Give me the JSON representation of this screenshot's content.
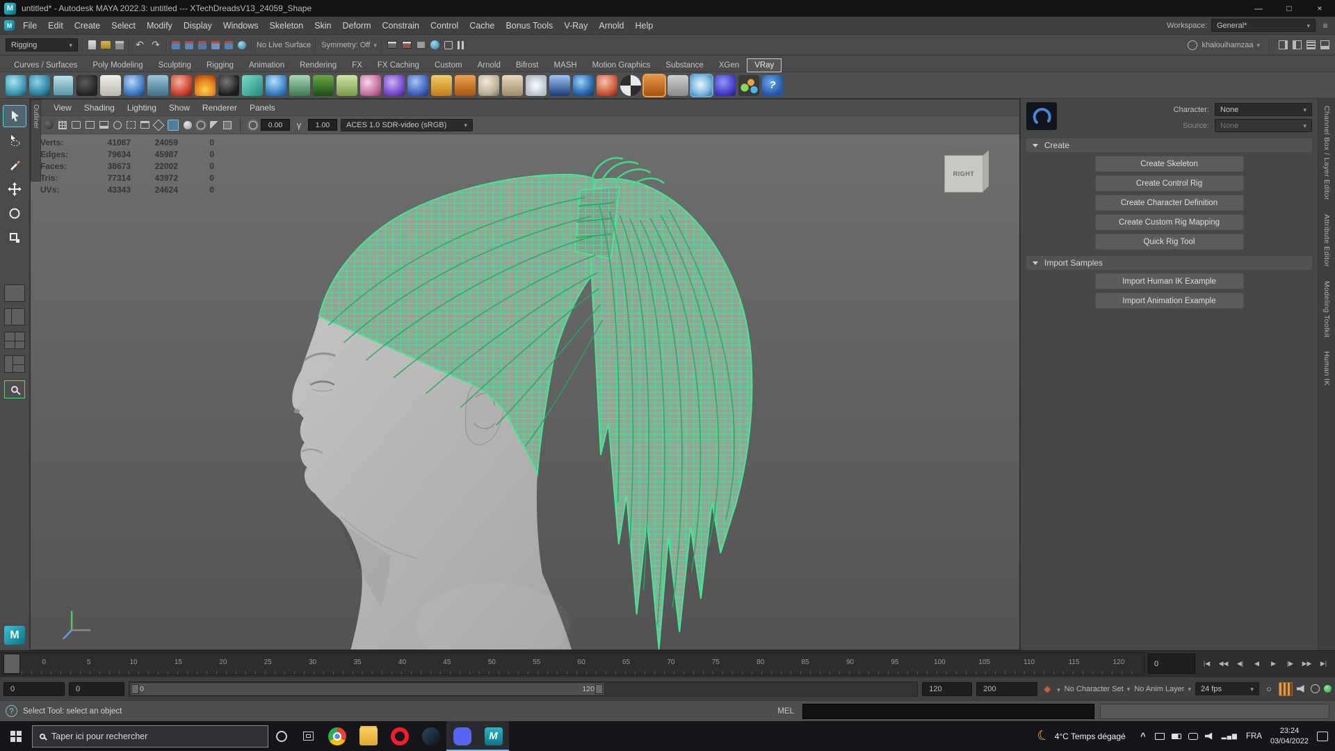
{
  "window": {
    "title": "untitled* - Autodesk MAYA 2022.3: untitled   ---   XTechDreadsV13_24059_Shape",
    "maya_logo_glyph": "M",
    "minimize": "—",
    "maximize": "□",
    "close": "×"
  },
  "menu_bar": {
    "items": [
      "File",
      "Edit",
      "Create",
      "Select",
      "Modify",
      "Display",
      "Windows",
      "Skeleton",
      "Skin",
      "Deform",
      "Constrain",
      "Control",
      "Cache",
      "Bonus Tools",
      "V-Ray",
      "Arnold",
      "Help"
    ],
    "workspace_label": "Workspace:",
    "workspace_value": "General*"
  },
  "status_line": {
    "mode_selector": "Rigging",
    "file_icons": [
      {
        "name": "new-scene-icon",
        "style": "width:11px;height:13px;background:linear-gradient(#dcdcdc,#b2b2b2);border-radius:1px"
      },
      {
        "name": "open-scene-icon",
        "style": "width:14px;height:11px;background:linear-gradient(#d8b450,#b08428);border-radius:2px"
      },
      {
        "name": "save-scene-icon",
        "style": "width:12px;height:12px;background:linear-gradient(#bdbdbd 0 30%,#8a8a8a 30%);border-radius:1px"
      }
    ],
    "history_icons": [
      {
        "name": "undo-icon",
        "glyph": "↶",
        "style": "color:#c9c9c9;font-size:14px"
      },
      {
        "name": "redo-icon",
        "glyph": "↷",
        "style": "color:#c9c9c9;font-size:14px"
      }
    ],
    "snap_icons": [
      {
        "name": "snap-grid-icon",
        "style": "width:12px;height:12px;border-radius:2px;background:linear-gradient(#b84a38 0 30%,#4a86ba 30%)"
      },
      {
        "name": "snap-curve-icon",
        "style": "width:12px;height:12px;border-radius:2px;background:linear-gradient(#b84a38 0 30%,#558cc0 30%)"
      },
      {
        "name": "snap-point-icon",
        "style": "width:12px;height:12px;border-radius:2px;background:linear-gradient(#b84a38 0 30%,#4a7ab0 30%)"
      },
      {
        "name": "snap-projected-center-icon",
        "style": "width:12px;height:12px;border-radius:2px;background:linear-gradient(#b84a38 0 30%,#6a96c4 30%)"
      },
      {
        "name": "snap-view-plane-icon",
        "style": "width:12px;height:12px;border-radius:2px;background:linear-gradient(#b84a38 0 30%,#4a86ba 30%)"
      },
      {
        "name": "make-live-icon",
        "style": "width:12px;height:12px;border-radius:50%;background:radial-gradient(circle at 35% 30%,#9adcf0,#2a7c9c)"
      }
    ],
    "live_surface": "No Live Surface",
    "symmetry": "Symmetry: Off",
    "render_icons": [
      {
        "name": "render-frame-icon",
        "style": "width:14px;height:11px;border:1px solid #2e2e2e;background:linear-gradient(#d8d8d8 0 30%,#666 30%)"
      },
      {
        "name": "ipr-render-icon",
        "style": "width:14px;height:11px;border:1px solid #2e2e2e;background:linear-gradient(#d8d8d8 0 30%,#8a5a4a 30%)"
      },
      {
        "name": "render-settings-icon",
        "style": "width:13px;height:11px;background:#9a9a9a;border:1px solid #444"
      },
      {
        "name": "render-view-icon",
        "style": "width:13px;height:13px;border-radius:50%;background:radial-gradient(circle at 35% 30%,#9adcf0,#2a7c9c)"
      },
      {
        "name": "launch-mash-icon",
        "style": "width:12px;height:12px;border:1px solid #c4c4c4;border-radius:2px"
      },
      {
        "name": "pause-viewport-icon",
        "style": "width:9px;height:12px;background:linear-gradient(90deg,#c8c8c8 0 3px,transparent 3px 6px,#c8c8c8 6px 9px)"
      }
    ],
    "account": "khalouihamzaa",
    "sidebar_icons": [
      {
        "name": "attribute-editor-toggle-icon",
        "style": "width:13px;height:13px;border:1px solid #b8b8b8;background:linear-gradient(90deg,transparent 0 8px,#b8b8b8 8px)"
      },
      {
        "name": "tool-settings-toggle-icon",
        "style": "width:13px;height:13px;border:1px solid #b8b8b8;background:linear-gradient(90deg,#b8b8b8 0 4px,transparent 4px)"
      },
      {
        "name": "channel-box-toggle-icon",
        "style": "width:13px;height:13px;border:1px solid #b8b8b8;background:repeating-linear-gradient(0deg,#b8b8b8 0 2px,transparent 2px 4px)"
      },
      {
        "name": "workspace-panel-toggle-icon",
        "style": "width:13px;height:13px;border:1px solid #b8b8b8;background:linear-gradient(0deg,#b8b8b8 0 4px,transparent 4px)"
      }
    ]
  },
  "shelf": {
    "tabs": [
      {
        "label": "Curves / Surfaces",
        "active": "false"
      },
      {
        "label": "Poly Modeling",
        "active": "false"
      },
      {
        "label": "Sculpting",
        "active": "false"
      },
      {
        "label": "Rigging",
        "active": "false"
      },
      {
        "label": "Animation",
        "active": "false"
      },
      {
        "label": "Rendering",
        "active": "false"
      },
      {
        "label": "FX",
        "active": "false"
      },
      {
        "label": "FX Caching",
        "active": "false"
      },
      {
        "label": "Custom",
        "active": "false"
      },
      {
        "label": "Arnold",
        "active": "false"
      },
      {
        "label": "Bifrost",
        "active": "false"
      },
      {
        "label": "MASH",
        "active": "false"
      },
      {
        "label": "Motion Graphics",
        "active": "false"
      },
      {
        "label": "Substance",
        "active": "false"
      },
      {
        "label": "XGen",
        "active": "false"
      },
      {
        "label": "VRay",
        "active": "true"
      }
    ],
    "icons": [
      {
        "name": "wire-sphere-icon",
        "style": "background:radial-gradient(circle at 38% 32%,#aee4ef,#3e98b4 60%,#174654)"
      },
      {
        "name": "wire-spheres-pair-icon",
        "style": "background:radial-gradient(circle at 38% 32%,#8ed4e4,#2f84a4 62%,#123c4c)"
      },
      {
        "name": "uv-grid-icon",
        "style": "background:linear-gradient(#bfe2ea,#5b93a4);box-shadow:inset 0 0 0 1px #2e5866"
      },
      {
        "name": "dark-teapot-icon",
        "style": "background:radial-gradient(circle at 40% 35%,#5c5c5c,#222 70%)"
      },
      {
        "name": "notes-icon",
        "style": "background:linear-gradient(#f0efe8,#b9b8b0)"
      },
      {
        "name": "blue-sphere-icon",
        "style": "background:radial-gradient(circle at 38% 32%,#bcd8f6,#3f7cc4 60%,#163a6c)"
      },
      {
        "name": "characters-icon",
        "style": "background:linear-gradient(#9cc6da,#41708a)"
      },
      {
        "name": "red-sphere-icon",
        "style": "background:radial-gradient(circle at 38% 32%,#f4b0a2,#cf4632 60%,#6e150c)"
      },
      {
        "name": "fire-icon",
        "style": "background:radial-gradient(circle at 50% 70%,#f6d34a,#e77f1f 55%,#98330a)"
      },
      {
        "name": "black-sphere-icon",
        "style": "background:radial-gradient(circle at 38% 32%,#777,#1c1c1c 70%)"
      },
      {
        "name": "cube-icon",
        "style": "background:linear-gradient(135deg,#7adbc8,#1f8a78)"
      },
      {
        "name": "water-drop-icon",
        "style": "background:radial-gradient(circle at 40% 30%,#b8e0f8,#3f86c8 60%,#184a80)"
      },
      {
        "name": "terrain-icon",
        "style": "background:linear-gradient(#a8d8b4,#3e7a54)"
      },
      {
        "name": "grass-icon",
        "style": "background:linear-gradient(#68a844,#1d4c16)"
      },
      {
        "name": "fur-icon",
        "style": "background:linear-gradient(#cfe2a4,#7a9a4a)"
      },
      {
        "name": "flowers-icon",
        "style": "background:radial-gradient(circle at 35% 35%,#f6d7e8,#c06a9a 65%,#7a3460)"
      },
      {
        "name": "swirl-icon",
        "style": "background:radial-gradient(circle at 40% 35%,#cab4f2,#7a4ecf 60%,#3a2080)"
      },
      {
        "name": "ring-sphere-icon",
        "style": "background:radial-gradient(circle at 38% 32%,#a8c4f4,#4468c0 60%,#1c3070)"
      },
      {
        "name": "dome-icon",
        "style": "background:linear-gradient(#f4ce66,#c07c18)"
      },
      {
        "name": "funnel-icon",
        "style": "background:linear-gradient(#eda24e,#a4540e)"
      },
      {
        "name": "clay-sphere-icon",
        "style": "background:radial-gradient(circle at 38% 32%,#f2ead8,#b8ae94 65%,#6f6850)"
      },
      {
        "name": "cone-icon",
        "style": "background:linear-gradient(#ead9bc,#9e8c68)"
      },
      {
        "name": "snowflake-icon",
        "style": "background:radial-gradient(circle at 50% 50%,#fff,#b8c2cc 70%)"
      },
      {
        "name": "ramp-icon",
        "style": "background:linear-gradient(180deg,#9cc4f0,#1c3c78)"
      },
      {
        "name": "glossy-sphere-icon",
        "style": "background:radial-gradient(circle at 38% 32%,#9ed0f4,#2a6ab0 60%,#123458)"
      },
      {
        "name": "vray-sphere-icon",
        "style": "background:radial-gradient(circle at 38% 32%,#f4c4b4,#cf5a3a 60%,#701f10)"
      },
      {
        "name": "checker-sphere-icon",
        "style": "background:conic-gradient(#e8e8e8 0 25%,#2c2c2c 0 50%,#e8e8e8 0 75%,#2c2c2c 0);border-radius:50%"
      },
      {
        "name": "orange-shader-icon",
        "style": "background:linear-gradient(#e8944a,#a4520e);outline:2px solid #e8a04a"
      },
      {
        "name": "teapot-plus-icon",
        "style": "background:linear-gradient(#cfcfcf,#8a8a8a)"
      },
      {
        "name": "cloud-icon",
        "style": "background:radial-gradient(circle at 45% 45%,#e8f4fc,#7ab8e0 60%,#2a6aa0);outline:2px solid #6aa8d8"
      },
      {
        "name": "vray-logo-icon",
        "style": "background:radial-gradient(circle at 40% 35%,#8a9af2,#4a3ecf 60%,#201a70)"
      },
      {
        "name": "particles-icon",
        "style": "background:radial-gradient(circle at 30% 60%,#8ad858 20%,transparent 21%),radial-gradient(circle at 60% 35%,#e8a040 18%,transparent 19%),radial-gradient(circle at 75% 70%,#48b8e8 16%,transparent 17%),#3a3a3a"
      },
      {
        "name": "help-icon",
        "glyph": "?",
        "style": "background:radial-gradient(circle at 40% 35%,#6aa8e8,#2456a8 70%);color:#fff;font-size:15px;font-weight:bold"
      }
    ]
  },
  "viewport": {
    "outliner_tab": "Outliner",
    "panel_menus": [
      "View",
      "Shading",
      "Lighting",
      "Show",
      "Renderer",
      "Panels"
    ],
    "toolbar_icons": [
      {
        "name": "target-camera-icon",
        "style": "width:13px;height:13px;border-radius:50%;background:radial-gradient(circle at 35% 30%,#6a6a6a,#2a2a2a)"
      },
      {
        "name": "grid-icon",
        "style": "width:12px;height:12px;background:repeating-linear-gradient(90deg,#c4c4c4 0 1px,transparent 1px 4px),repeating-linear-gradient(0deg,#c4c4c4 0 1px,transparent 1px 4px);border:1px solid #c4c4c4"
      },
      {
        "name": "film-gate-icon",
        "style": "width:13px;height:11px;border:1px solid #c4c4c4;border-radius:2px"
      },
      {
        "name": "resolution-gate-icon",
        "style": "width:13px;height:11px;border:1px solid #c4c4c4"
      },
      {
        "name": "gate-mask-icon",
        "style": "width:13px;height:11px;border:1px solid #c4c4c4;background:linear-gradient(0deg,#c4c4c4 0 3px,transparent 3px)"
      },
      {
        "name": "field-chart-icon",
        "style": "width:12px;height:12px;border:1px solid #c4c4c4;border-radius:50%"
      },
      {
        "name": "safe-action-icon",
        "style": "width:13px;height:11px;border:1px dashed #c4c4c4"
      },
      {
        "name": "safe-title-icon",
        "style": "width:13px;height:11px;border:1px solid #c4c4c4;background:linear-gradient(#c4c4c4 0 2px,transparent 2px)"
      },
      {
        "name": "wireframe-icon",
        "style": "width:12px;height:12px;border:1px solid #c4c4c4;transform:rotate(45deg)"
      },
      {
        "name": "shaded-mode-icon",
        "style": "width:16px;height:16px;border-radius:2px;background:#4f7e99;box-shadow:inset 0 0 0 1px #7fc0de"
      },
      {
        "name": "textured-mode-icon",
        "style": "width:12px;height:12px;border-radius:50%;background:radial-gradient(circle at 35% 30%,#e8e8e8,#9a9a9a)"
      },
      {
        "name": "lights-icon",
        "style": "width:12px;height:12px;border-radius:50%;border:1px solid #c4c4c4;box-shadow:0 0 0 2px rgba(200,200,200,.25)"
      },
      {
        "name": "shadows-icon",
        "style": "width:12px;height:12px;background:linear-gradient(135deg,#c4c4c4 0 50%,#555 50%);border-radius:2px"
      },
      {
        "name": "xray-icon",
        "style": "width:12px;height:12px;border:1px solid #c4c4c4;background:rgba(196,196,196,.3)"
      }
    ],
    "exposure_icon": {
      "name": "exposure-icon",
      "style": "width:12px;height:12px;border-radius:50%;border:1px solid #c4c4c4;box-shadow:0 0 0 2px rgba(200,200,200,.25)"
    },
    "gamma_icon": {
      "name": "gamma-icon",
      "glyph": "γ",
      "style": "color:#c8c8c8;font-size:13px"
    },
    "exposure": "0.00",
    "gamma": "1.00",
    "color_space": "ACES 1.0 SDR-video (sRGB)",
    "view_cube_label": "RIGHT",
    "hud_rows": [
      {
        "label": "Verts:",
        "total": "41087",
        "selected": "24059",
        "other": "0"
      },
      {
        "label": "Edges:",
        "total": "79634",
        "selected": "45987",
        "other": "0"
      },
      {
        "label": "Faces:",
        "total": "38673",
        "selected": "22002",
        "other": "0"
      },
      {
        "label": "Tris:",
        "total": "77314",
        "selected": "43972",
        "other": "0"
      },
      {
        "label": "UVs:",
        "total": "43343",
        "selected": "24624",
        "other": "0"
      }
    ]
  },
  "right_panel": {
    "character_label": "Character:",
    "character_value": "None",
    "source_label": "Source:",
    "source_value": "None",
    "sections": [
      {
        "title": "Create",
        "buttons": [
          "Create Skeleton",
          "Create Control Rig",
          "Create Character Definition",
          "Create Custom Rig Mapping",
          "Quick Rig Tool"
        ]
      },
      {
        "title": "Import Samples",
        "buttons": [
          "Import Human IK Example",
          "Import Animation Example"
        ]
      }
    ]
  },
  "right_strip": {
    "tabs": [
      "Channel Box / Layer Editor",
      "Attribute Editor",
      "Modeling Toolkit",
      "Human IK"
    ]
  },
  "timeline": {
    "ticks": [
      "0",
      "5",
      "10",
      "15",
      "20",
      "25",
      "30",
      "35",
      "40",
      "45",
      "50",
      "55",
      "60",
      "65",
      "70",
      "75",
      "80",
      "85",
      "90",
      "95",
      "100",
      "105",
      "110",
      "115",
      "120"
    ],
    "current_frame_field": "0",
    "playback": [
      {
        "name": "go-to-start-button",
        "glyph": "|◀"
      },
      {
        "name": "step-back-key-button",
        "glyph": "◀◀"
      },
      {
        "name": "step-back-frame-button",
        "glyph": "◀|"
      },
      {
        "name": "play-backward-button",
        "glyph": "◀"
      },
      {
        "name": "play-forward-button",
        "glyph": "▶"
      },
      {
        "name": "step-forward-frame-button",
        "glyph": "|▶"
      },
      {
        "name": "step-forward-key-button",
        "glyph": "▶▶"
      },
      {
        "name": "go-to-end-button",
        "glyph": "▶|"
      }
    ]
  },
  "range_bar": {
    "anim_start": "0",
    "playback_start": "0",
    "slider_start_label": "0",
    "slider_end_label": "120",
    "playback_end": "120",
    "anim_end": "200",
    "character_set": "No Character Set",
    "anim_layer": "No Anim Layer",
    "fps": "24 fps"
  },
  "command_line": {
    "help_text": "Select Tool: select an object",
    "mel_label": "MEL"
  },
  "taskbar": {
    "search_placeholder": "Taper ici pour rechercher",
    "apps": [
      {
        "name": "chrome-icon",
        "active": "false",
        "style": "background:radial-gradient(circle,#4a90e2 0 20%,#fff 21% 32%,transparent 33%),conic-gradient(#ea4335 0 33%,#fbbc05 0 66%,#34a853 0);border-radius:50%"
      },
      {
        "name": "file-explorer-icon",
        "active": "false",
        "style": "background:linear-gradient(#f8d264,#e0a82e);border-radius:3px;box-shadow:0 -3px 0 -1px #e8bc48"
      },
      {
        "name": "opera-icon",
        "active": "false",
        "style": "background:radial-gradient(circle,transparent 0 38%,#ff1b2d 39%);border-radius:50%"
      },
      {
        "name": "steam-icon",
        "active": "false",
        "style": "background:linear-gradient(135deg,#2a475e,#10161d);border-radius:50%"
      },
      {
        "name": "discord-icon",
        "active": "true",
        "style": "background:#5865f2;border-radius:8px"
      },
      {
        "name": "maya-taskbar-icon",
        "active": "true",
        "glyph": "M",
        "style": "background:linear-gradient(#29b6c5,#0b7488);border-radius:4px;color:#fff;font-weight:bold;font-size:15px"
      }
    ],
    "weather_temp": "4°C",
    "weather_desc": "Temps dégagé",
    "tray": [
      {
        "name": "tray-expand-icon",
        "glyph": "^",
        "style": "color:#e0e0e0;font-size:13px;font-weight:bold"
      },
      {
        "name": "display-icon",
        "style": "width:13px;height:10px;border:1px solid #e0e0e0;border-radius:1px"
      },
      {
        "name": "battery-icon",
        "style": "width:14px;height:8px;border:1px solid #e0e0e0;border-radius:1px;background:linear-gradient(90deg,#e0e0e0 0 70%,transparent 70%)"
      },
      {
        "name": "microphone-icon",
        "style": "width:5px;height:10px;border:1px solid #e0e0e0;border-radius:3px"
      },
      {
        "name": "speaker-icon",
        "style": "width:13px;height:12px;background:#e0e0e0;clip-path:polygon(0 35%,35% 35%,75% 8%,75% 92%,35% 65%,0 65%)"
      },
      {
        "name": "network-icon",
        "glyph": "▂▄▆",
        "style": "color:#e0e0e0;font-size:9px;letter-spacing:1px"
      }
    ],
    "lang": "FRA",
    "time": "23:24",
    "date": "03/04/2022"
  }
}
